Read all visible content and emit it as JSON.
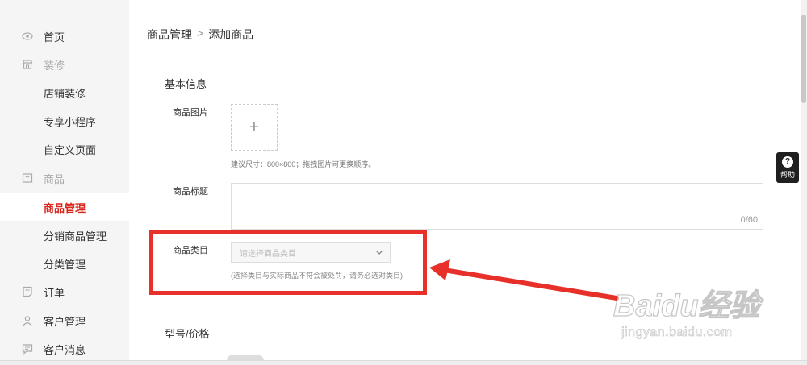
{
  "sidebar": {
    "items": [
      {
        "label": "首页",
        "icon": "eye-icon",
        "type": "item"
      },
      {
        "label": "装修",
        "icon": "shop-icon",
        "type": "group"
      },
      {
        "label": "店铺装修",
        "type": "sub"
      },
      {
        "label": "专享小程序",
        "type": "sub"
      },
      {
        "label": "自定义页面",
        "type": "sub"
      },
      {
        "label": "商品",
        "icon": "box-icon",
        "type": "group"
      },
      {
        "label": "商品管理",
        "type": "sub",
        "active": true
      },
      {
        "label": "分销商品管理",
        "type": "sub"
      },
      {
        "label": "分类管理",
        "type": "sub"
      },
      {
        "label": "订单",
        "icon": "order-icon",
        "type": "item"
      },
      {
        "label": "客户管理",
        "icon": "user-icon",
        "type": "item"
      },
      {
        "label": "客户消息",
        "icon": "message-icon",
        "type": "item"
      }
    ]
  },
  "breadcrumb": {
    "parent": "商品管理",
    "separator": ">",
    "current": "添加商品"
  },
  "form": {
    "basic_section_title": "基本信息",
    "image_label": "商品图片",
    "image_add_symbol": "+",
    "image_hint": "建议尺寸：800×800；拖拽图片可更换顺序。",
    "title_label": "商品标题",
    "title_value": "",
    "title_counter": "0/60",
    "category_label": "商品类目",
    "category_placeholder": "请选择商品类目",
    "category_hint": "(选择类目与实际商品不符会被处罚，请务必选对类目)",
    "model_section_title": "型号/价格"
  },
  "help": {
    "label": "帮助",
    "icon": "question-icon"
  },
  "watermark": {
    "brand": "Baidu经验",
    "url": "jingyan.baidu.com"
  },
  "colors": {
    "accent": "#d9261c",
    "highlight": "#e8302a",
    "sidebar_bg": "#f5f5f5"
  }
}
